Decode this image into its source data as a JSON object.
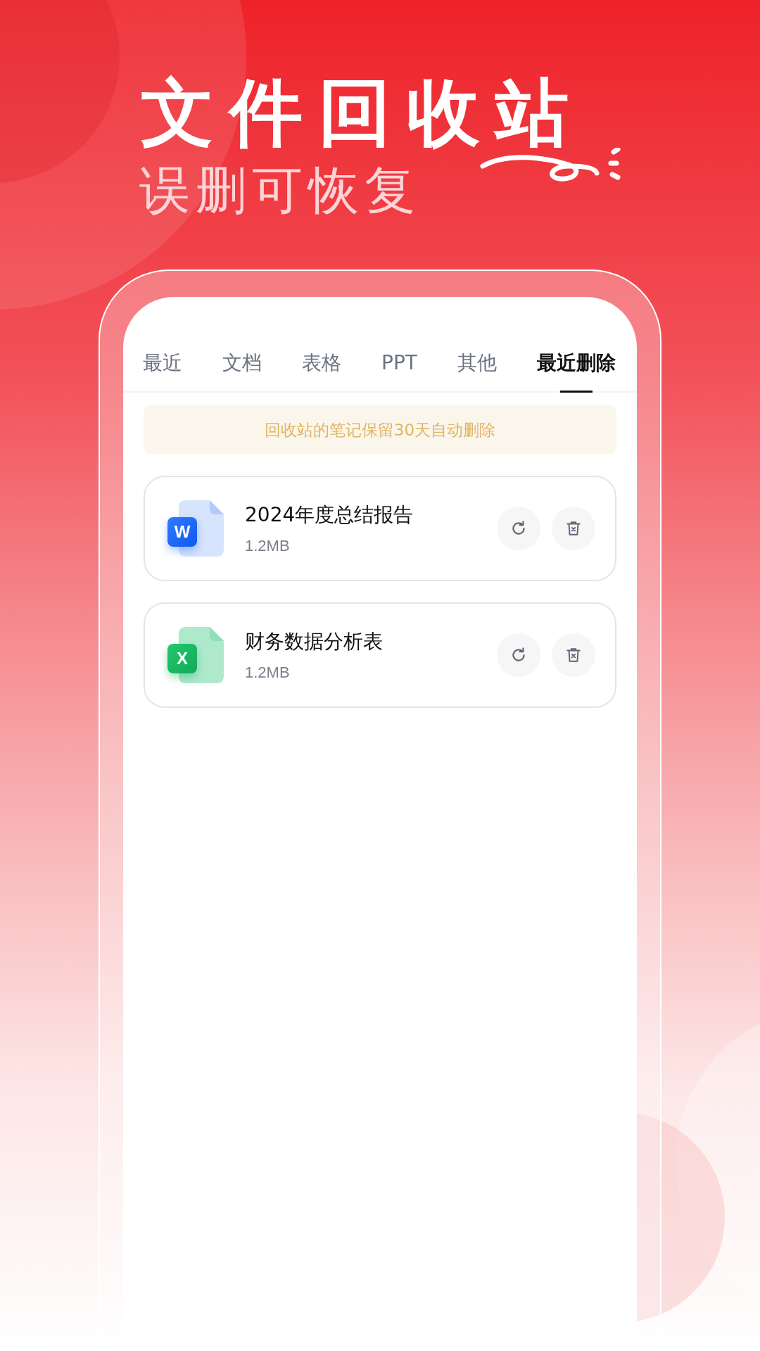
{
  "headline": "文件回收站",
  "subheadline": "误删可恢复",
  "tabs": [
    {
      "label": "最近",
      "selected": false
    },
    {
      "label": "文档",
      "selected": false
    },
    {
      "label": "表格",
      "selected": false
    },
    {
      "label": "PPT",
      "selected": false
    },
    {
      "label": "其他",
      "selected": false
    },
    {
      "label": "最近删除",
      "selected": true
    }
  ],
  "notice": "回收站的笔记保留30天自动删除",
  "files": [
    {
      "kind": "word",
      "badge": "W",
      "name": "2024年度总结报告",
      "size": "1.2MB"
    },
    {
      "kind": "excel",
      "badge": "X",
      "name": "财务数据分析表",
      "size": "1.2MB"
    }
  ]
}
